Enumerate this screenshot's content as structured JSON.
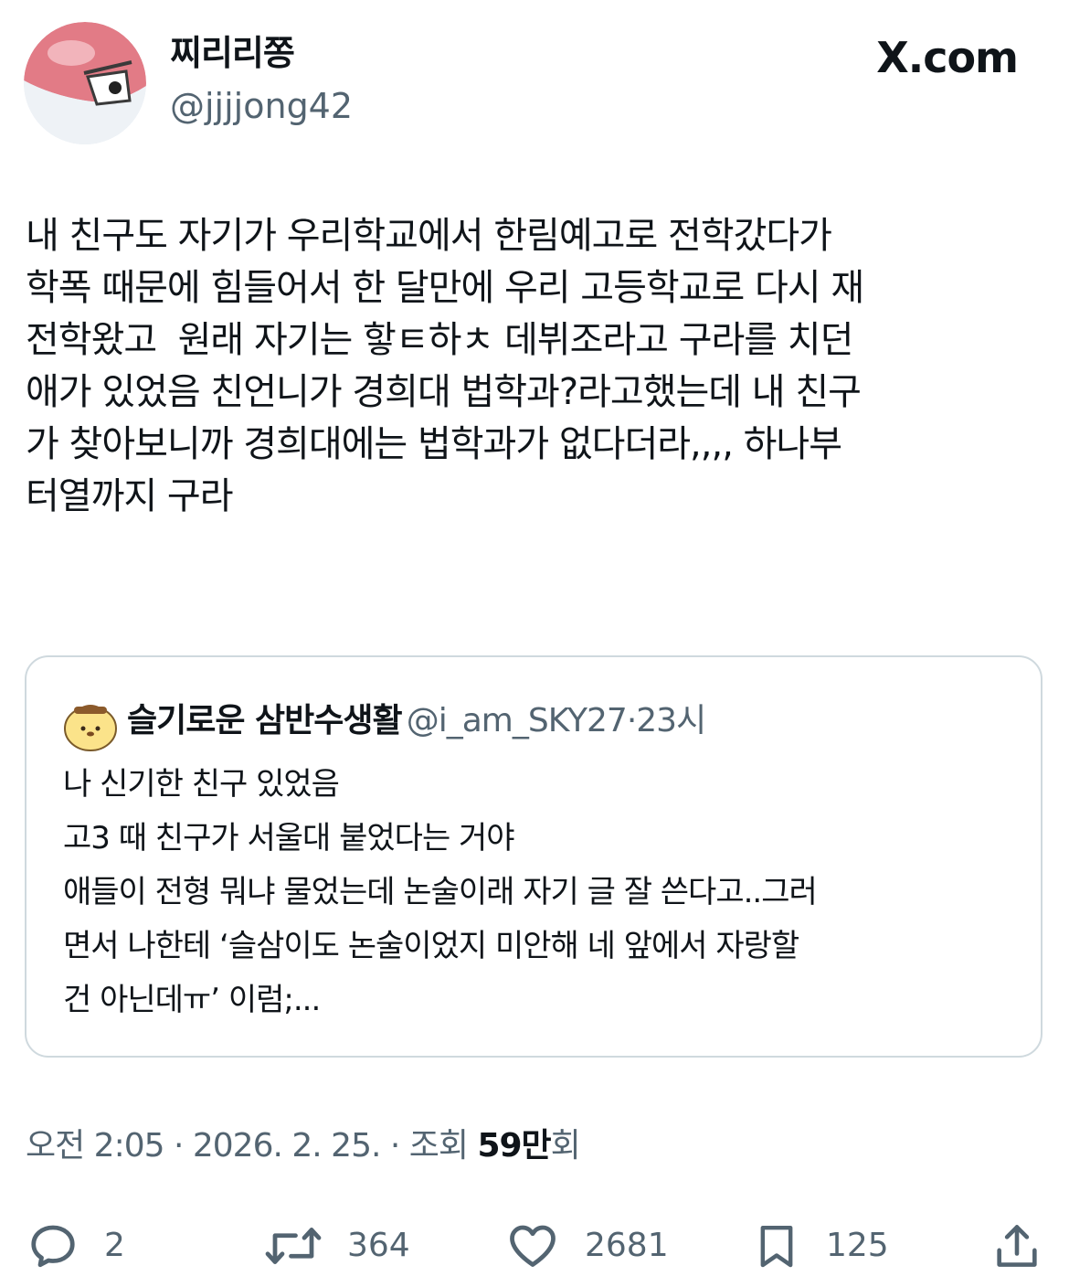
{
  "header": {
    "author_name": "찌리리쫑",
    "author_handle": "@jjjjong42",
    "avatar_icon": "voltorb-avatar-icon",
    "brand": "X.com"
  },
  "tweet": {
    "lines": [
      "내 친구도 자기가 우리학교에서 한림예고로 전학갔다가",
      "학폭 때문에 힘들어서 한 달만에 우리 고등학교로 다시 재",
      "전학왔고  원래 자기는 핳ㅌ하ㅊ 데뷔조라고 구라를 치던",
      "애가 있었음 친언니가 경희대 법학과?라고했는데 내 친구",
      "가 찾아보니까 경희대에는 법학과가 없다더라,,,, 하나부",
      "터열까지 구라"
    ]
  },
  "quote": {
    "avatar_icon": "pompompurin-avatar-icon",
    "name": "슬기로운 삼반수생활",
    "handle": "@i_am_SKY27",
    "separator": "·",
    "time": "23시",
    "lines": [
      "나 신기한 친구 있었음",
      "고3 때 친구가 서울대 붙었다는 거야",
      "애들이 전형 뭐냐 물었는데 논술이래 자기 글 잘 쓴다고..그러",
      "면서 나한테 ‘슬삼이도 논술이었지 미안해 네 앞에서 자랑할",
      "건 아닌데ㅠ’ 이럼;..."
    ]
  },
  "meta": {
    "time": "오전 2:05",
    "sep1": " · ",
    "date": "2026. 2. 25.",
    "sep2": " · ",
    "views_label": "조회 ",
    "views_count": "59만",
    "views_unit": "회"
  },
  "actions": {
    "reply": {
      "icon": "reply-icon",
      "count": "2"
    },
    "retweet": {
      "icon": "retweet-icon",
      "count": "364"
    },
    "like": {
      "icon": "heart-icon",
      "count": "2681"
    },
    "bookmark": {
      "icon": "bookmark-icon",
      "count": "125"
    },
    "share": {
      "icon": "share-icon"
    }
  },
  "colors": {
    "text": "#0f1419",
    "secondary": "#536471",
    "border": "#cfd9de",
    "avatar_red": "#e0707a",
    "background": "#ffffff"
  }
}
